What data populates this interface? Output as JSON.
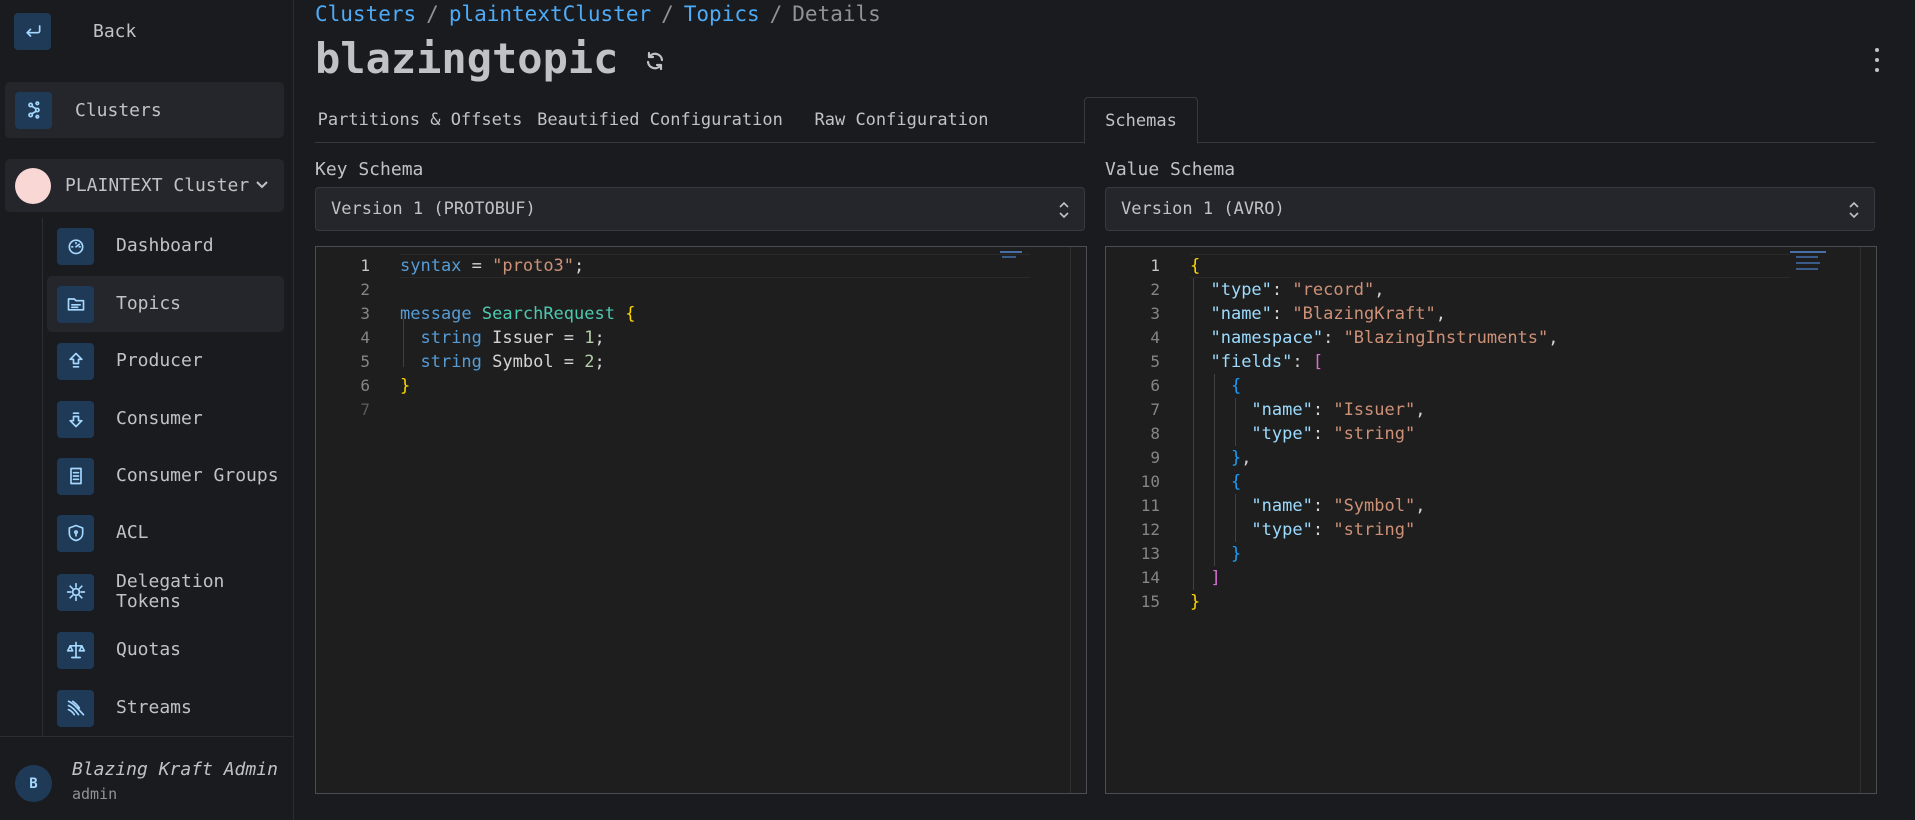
{
  "sidebar": {
    "back_label": "Back",
    "clusters_label": "Clusters",
    "cluster_name": "PLAINTEXT Cluster",
    "items": [
      {
        "label": "Dashboard",
        "icon": "dashboard-icon"
      },
      {
        "label": "Topics",
        "icon": "topics-icon",
        "active": true
      },
      {
        "label": "Producer",
        "icon": "producer-icon"
      },
      {
        "label": "Consumer",
        "icon": "consumer-icon"
      },
      {
        "label": "Consumer Groups",
        "icon": "consumer-groups-icon"
      },
      {
        "label": "ACL",
        "icon": "shield-icon"
      },
      {
        "label": "Delegation Tokens",
        "icon": "token-icon"
      },
      {
        "label": "Quotas",
        "icon": "scale-icon"
      },
      {
        "label": "Streams",
        "icon": "streams-icon"
      }
    ],
    "user": {
      "initial": "B",
      "name": "Blazing Kraft Admin",
      "role": "admin"
    }
  },
  "breadcrumb": {
    "items": [
      "Clusters",
      "plaintextCluster",
      "Topics"
    ],
    "current": "Details"
  },
  "title": "blazingtopic",
  "tabs": [
    "Partitions & Offsets",
    "Beautified Configuration",
    "Raw Configuration",
    "Schemas"
  ],
  "active_tab": "Schemas",
  "key_schema": {
    "label": "Key Schema",
    "selected": "Version 1 (PROTOBUF)",
    "line_numbers": [
      "1",
      "2",
      "3",
      "4",
      "5",
      "6",
      "7"
    ]
  },
  "value_schema": {
    "label": "Value Schema",
    "selected": "Version 1 (AVRO)",
    "line_numbers": [
      "1",
      "2",
      "3",
      "4",
      "5",
      "6",
      "7",
      "8",
      "9",
      "10",
      "11",
      "12",
      "13",
      "14",
      "15"
    ]
  },
  "colors": {
    "accent_link": "#4dabf7",
    "icon_bg": "#1f3a56",
    "cluster_dot": "#f8d7d5"
  }
}
